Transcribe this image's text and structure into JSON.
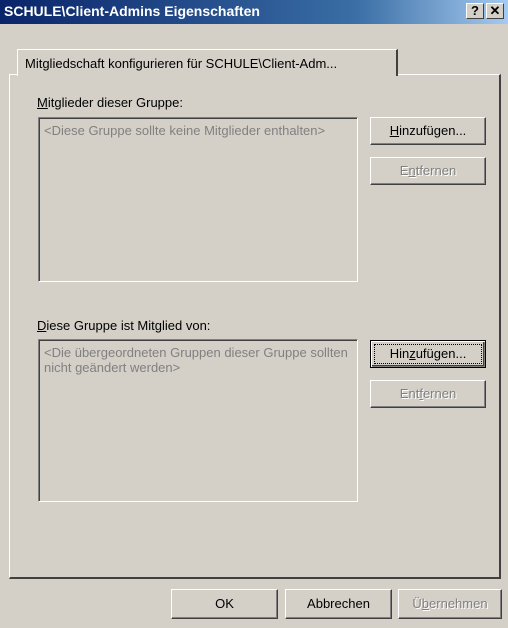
{
  "window": {
    "title": "SCHULE\\Client-Admins Eigenschaften",
    "help_button": "?",
    "close_button": "✕"
  },
  "tab": {
    "label": "Mitgliedschaft konfigurieren für SCHULE\\Client-Adm..."
  },
  "members_section": {
    "label_u": "M",
    "label_rest": "itglieder dieser Gruppe:",
    "list_text": "<Diese Gruppe sollte keine Mitglieder enthalten>",
    "add_u": "H",
    "add_rest": "inzufügen...",
    "remove_pre": "E",
    "remove_u": "n",
    "remove_rest": "tfernen"
  },
  "member_of_section": {
    "label_u": "D",
    "label_rest": "iese Gruppe ist Mitglied von:",
    "list_text": "<Die übergeordneten Gruppen dieser Gruppe sollten nicht geändert werden>",
    "add_pre": "Hin",
    "add_u": "z",
    "add_rest": "ufügen...",
    "remove_pre": "Ent",
    "remove_u": "f",
    "remove_rest": "ernen"
  },
  "footer": {
    "ok": "OK",
    "cancel": "Abbrechen",
    "apply_pre": "Ü",
    "apply_u": "b",
    "apply_rest": "ernehmen"
  }
}
